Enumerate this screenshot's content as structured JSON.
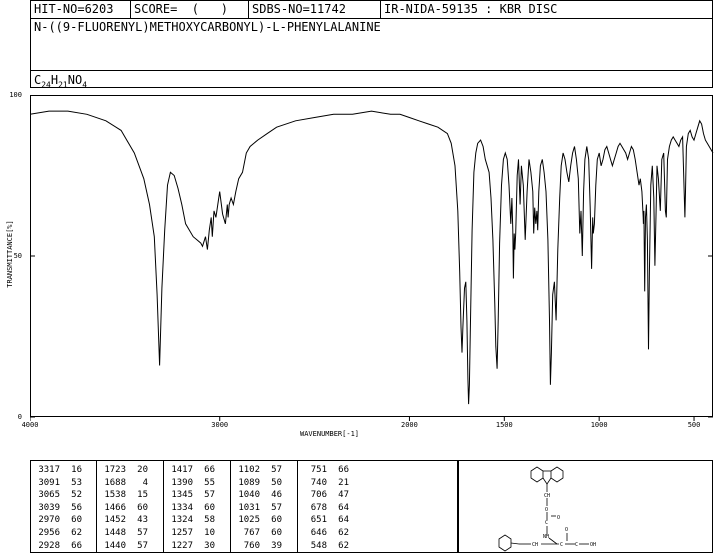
{
  "header": {
    "hit_no": "HIT-NO=6203",
    "score": "SCORE=  (   )",
    "sdbs_no": "SDBS-NO=11742",
    "ir_id": "IR-NIDA-59135 : KBR DISC",
    "compound_name": "N-((9-FLUORENYL)METHOXYCARBONYL)-L-PHENYLALANINE",
    "formula_parts": [
      "C",
      "24",
      "H",
      "21",
      "NO",
      "4"
    ]
  },
  "chart_data": {
    "type": "line",
    "xlabel": "WAVENUMBER[-1]",
    "ylabel": "TRANSMITTANCE[%]",
    "xlim": [
      4000,
      400
    ],
    "ylim": [
      0,
      100
    ],
    "x_ticks": [
      4000,
      3000,
      2000,
      1500,
      1000,
      500
    ],
    "y_ticks": [
      0,
      50,
      100
    ],
    "grid": false,
    "series": [
      {
        "points": [
          [
            4000,
            94
          ],
          [
            3900,
            95
          ],
          [
            3800,
            95
          ],
          [
            3700,
            94
          ],
          [
            3600,
            92
          ],
          [
            3520,
            89
          ],
          [
            3450,
            82
          ],
          [
            3400,
            74
          ],
          [
            3370,
            66
          ],
          [
            3345,
            56
          ],
          [
            3330,
            38
          ],
          [
            3317,
            16
          ],
          [
            3305,
            40
          ],
          [
            3290,
            58
          ],
          [
            3275,
            72
          ],
          [
            3260,
            76
          ],
          [
            3240,
            75
          ],
          [
            3220,
            71
          ],
          [
            3200,
            66
          ],
          [
            3180,
            60
          ],
          [
            3160,
            58
          ],
          [
            3140,
            56
          ],
          [
            3120,
            55
          ],
          [
            3100,
            54
          ],
          [
            3091,
            53
          ],
          [
            3075,
            56
          ],
          [
            3065,
            52
          ],
          [
            3055,
            58
          ],
          [
            3045,
            62
          ],
          [
            3039,
            56
          ],
          [
            3030,
            64
          ],
          [
            3020,
            62
          ],
          [
            3010,
            66
          ],
          [
            3000,
            70
          ],
          [
            2985,
            63
          ],
          [
            2970,
            60
          ],
          [
            2960,
            66
          ],
          [
            2956,
            62
          ],
          [
            2950,
            66
          ],
          [
            2940,
            68
          ],
          [
            2928,
            66
          ],
          [
            2915,
            70
          ],
          [
            2900,
            74
          ],
          [
            2880,
            76
          ],
          [
            2860,
            82
          ],
          [
            2840,
            84
          ],
          [
            2800,
            86
          ],
          [
            2750,
            88
          ],
          [
            2700,
            90
          ],
          [
            2600,
            92
          ],
          [
            2500,
            93
          ],
          [
            2400,
            94
          ],
          [
            2300,
            94
          ],
          [
            2200,
            95
          ],
          [
            2100,
            94
          ],
          [
            2050,
            94
          ],
          [
            2000,
            93
          ],
          [
            1950,
            92
          ],
          [
            1900,
            91
          ],
          [
            1850,
            90
          ],
          [
            1800,
            88
          ],
          [
            1780,
            85
          ],
          [
            1760,
            78
          ],
          [
            1745,
            64
          ],
          [
            1735,
            45
          ],
          [
            1728,
            28
          ],
          [
            1723,
            20
          ],
          [
            1718,
            28
          ],
          [
            1710,
            40
          ],
          [
            1703,
            42
          ],
          [
            1697,
            30
          ],
          [
            1692,
            12
          ],
          [
            1688,
            4
          ],
          [
            1684,
            10
          ],
          [
            1678,
            30
          ],
          [
            1670,
            58
          ],
          [
            1660,
            76
          ],
          [
            1650,
            82
          ],
          [
            1640,
            85
          ],
          [
            1625,
            86
          ],
          [
            1612,
            84
          ],
          [
            1600,
            80
          ],
          [
            1590,
            78
          ],
          [
            1580,
            76
          ],
          [
            1570,
            68
          ],
          [
            1560,
            55
          ],
          [
            1550,
            35
          ],
          [
            1545,
            22
          ],
          [
            1538,
            15
          ],
          [
            1532,
            30
          ],
          [
            1525,
            54
          ],
          [
            1515,
            72
          ],
          [
            1505,
            80
          ],
          [
            1495,
            82
          ],
          [
            1485,
            80
          ],
          [
            1475,
            72
          ],
          [
            1466,
            60
          ],
          [
            1460,
            68
          ],
          [
            1455,
            58
          ],
          [
            1452,
            43
          ],
          [
            1448,
            57
          ],
          [
            1444,
            52
          ],
          [
            1440,
            57
          ],
          [
            1432,
            75
          ],
          [
            1425,
            80
          ],
          [
            1417,
            66
          ],
          [
            1410,
            78
          ],
          [
            1400,
            72
          ],
          [
            1390,
            55
          ],
          [
            1380,
            70
          ],
          [
            1370,
            80
          ],
          [
            1360,
            76
          ],
          [
            1350,
            70
          ],
          [
            1345,
            57
          ],
          [
            1340,
            65
          ],
          [
            1334,
            60
          ],
          [
            1328,
            64
          ],
          [
            1324,
            58
          ],
          [
            1318,
            70
          ],
          [
            1310,
            78
          ],
          [
            1300,
            80
          ],
          [
            1290,
            76
          ],
          [
            1280,
            70
          ],
          [
            1270,
            55
          ],
          [
            1262,
            30
          ],
          [
            1257,
            10
          ],
          [
            1252,
            20
          ],
          [
            1245,
            38
          ],
          [
            1236,
            42
          ],
          [
            1227,
            30
          ],
          [
            1218,
            52
          ],
          [
            1208,
            68
          ],
          [
            1200,
            78
          ],
          [
            1190,
            82
          ],
          [
            1180,
            80
          ],
          [
            1170,
            76
          ],
          [
            1160,
            73
          ],
          [
            1150,
            78
          ],
          [
            1140,
            82
          ],
          [
            1130,
            84
          ],
          [
            1120,
            80
          ],
          [
            1110,
            74
          ],
          [
            1102,
            57
          ],
          [
            1096,
            64
          ],
          [
            1089,
            50
          ],
          [
            1082,
            70
          ],
          [
            1075,
            80
          ],
          [
            1065,
            84
          ],
          [
            1055,
            80
          ],
          [
            1047,
            65
          ],
          [
            1040,
            46
          ],
          [
            1034,
            62
          ],
          [
            1031,
            57
          ],
          [
            1025,
            60
          ],
          [
            1018,
            72
          ],
          [
            1010,
            80
          ],
          [
            1000,
            82
          ],
          [
            990,
            78
          ],
          [
            980,
            80
          ],
          [
            970,
            83
          ],
          [
            960,
            84
          ],
          [
            950,
            82
          ],
          [
            940,
            80
          ],
          [
            930,
            78
          ],
          [
            920,
            80
          ],
          [
            910,
            82
          ],
          [
            900,
            84
          ],
          [
            890,
            85
          ],
          [
            880,
            84
          ],
          [
            870,
            83
          ],
          [
            860,
            82
          ],
          [
            850,
            80
          ],
          [
            840,
            82
          ],
          [
            830,
            84
          ],
          [
            820,
            83
          ],
          [
            810,
            80
          ],
          [
            800,
            76
          ],
          [
            790,
            72
          ],
          [
            783,
            74
          ],
          [
            775,
            70
          ],
          [
            768,
            62
          ],
          [
            767,
            60
          ],
          [
            764,
            64
          ],
          [
            760,
            39
          ],
          [
            756,
            62
          ],
          [
            751,
            66
          ],
          [
            746,
            55
          ],
          [
            740,
            21
          ],
          [
            735,
            45
          ],
          [
            728,
            72
          ],
          [
            720,
            78
          ],
          [
            712,
            68
          ],
          [
            706,
            47
          ],
          [
            700,
            64
          ],
          [
            695,
            78
          ],
          [
            688,
            74
          ],
          [
            678,
            64
          ],
          [
            670,
            80
          ],
          [
            660,
            82
          ],
          [
            651,
            64
          ],
          [
            646,
            62
          ],
          [
            640,
            80
          ],
          [
            630,
            84
          ],
          [
            620,
            86
          ],
          [
            610,
            87
          ],
          [
            600,
            86
          ],
          [
            590,
            85
          ],
          [
            580,
            84
          ],
          [
            570,
            86
          ],
          [
            560,
            87
          ],
          [
            548,
            62
          ],
          [
            545,
            70
          ],
          [
            540,
            84
          ],
          [
            530,
            88
          ],
          [
            520,
            89
          ],
          [
            510,
            87
          ],
          [
            500,
            86
          ],
          [
            490,
            88
          ],
          [
            480,
            90
          ],
          [
            470,
            92
          ],
          [
            460,
            91
          ],
          [
            450,
            88
          ],
          [
            440,
            86
          ],
          [
            430,
            85
          ],
          [
            420,
            84
          ],
          [
            410,
            83
          ],
          [
            400,
            82
          ]
        ]
      }
    ]
  },
  "peak_table": {
    "columns": [
      [
        [
          "3317",
          "16"
        ],
        [
          "3091",
          "53"
        ],
        [
          "3065",
          "52"
        ],
        [
          "3039",
          "56"
        ],
        [
          "2970",
          "60"
        ],
        [
          "2956",
          "62"
        ],
        [
          "2928",
          "66"
        ]
      ],
      [
        [
          "1723",
          "20"
        ],
        [
          "1688",
          "4"
        ],
        [
          "1538",
          "15"
        ],
        [
          "1466",
          "60"
        ],
        [
          "1452",
          "43"
        ],
        [
          "1448",
          "57"
        ],
        [
          "1440",
          "57"
        ]
      ],
      [
        [
          "1417",
          "66"
        ],
        [
          "1390",
          "55"
        ],
        [
          "1345",
          "57"
        ],
        [
          "1334",
          "60"
        ],
        [
          "1324",
          "58"
        ],
        [
          "1257",
          "10"
        ],
        [
          "1227",
          "30"
        ]
      ],
      [
        [
          "1102",
          "57"
        ],
        [
          "1089",
          "50"
        ],
        [
          "1040",
          "46"
        ],
        [
          "1031",
          "57"
        ],
        [
          "1025",
          "60"
        ],
        [
          "767",
          "60"
        ],
        [
          "760",
          "39"
        ]
      ],
      [
        [
          "751",
          "66"
        ],
        [
          "740",
          "21"
        ],
        [
          "706",
          "47"
        ],
        [
          "678",
          "64"
        ],
        [
          "651",
          "64"
        ],
        [
          "646",
          "62"
        ],
        [
          "548",
          "62"
        ]
      ]
    ]
  },
  "structure": {
    "labels": [
      "CH",
      "O",
      "C",
      "O",
      "NH",
      "C",
      "C",
      "O",
      "OH",
      "CH"
    ]
  }
}
